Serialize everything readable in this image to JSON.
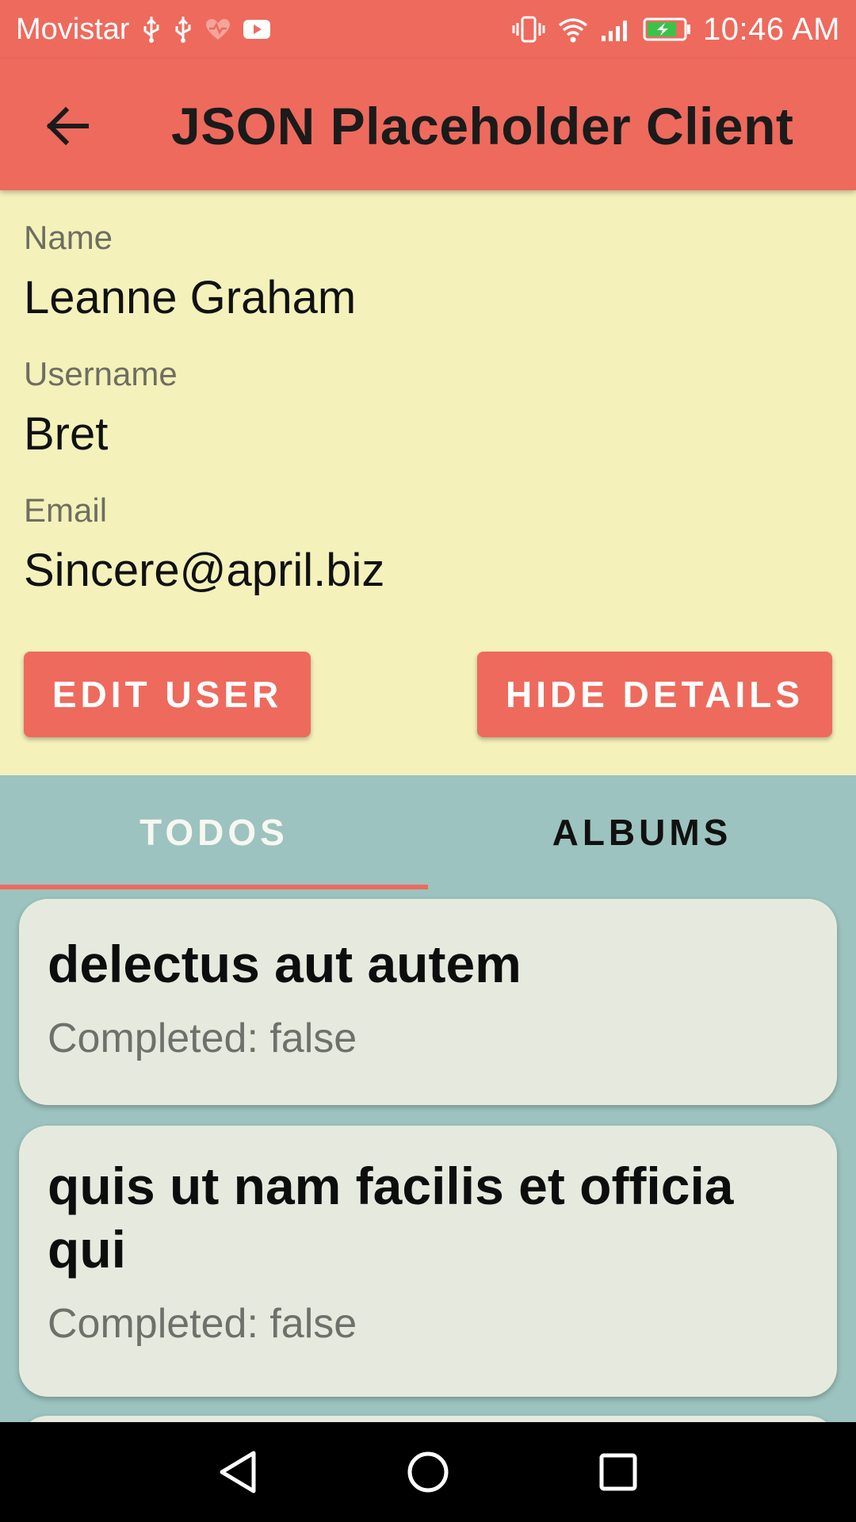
{
  "status_bar": {
    "carrier": "Movistar",
    "time": "10:46 AM"
  },
  "app_bar": {
    "title": "JSON Placeholder Client"
  },
  "user": {
    "name_label": "Name",
    "name": "Leanne Graham",
    "username_label": "Username",
    "username": "Bret",
    "email_label": "Email",
    "email": "Sincere@april.biz"
  },
  "actions": {
    "edit_label": "EDIT USER",
    "hide_label": "HIDE DETAILS"
  },
  "tabs": [
    {
      "label": "TODOS",
      "selected": true
    },
    {
      "label": "ALBUMS",
      "selected": false
    }
  ],
  "todos": [
    {
      "title": "delectus aut autem",
      "status": "Completed: false"
    },
    {
      "title": "quis ut nam facilis et officia qui",
      "status": "Completed: false"
    }
  ],
  "colors": {
    "accent": "#ee6a5d",
    "details_bg": "#f4f1bb",
    "list_bg": "#9cc3bf",
    "card_bg": "#e6eade"
  }
}
